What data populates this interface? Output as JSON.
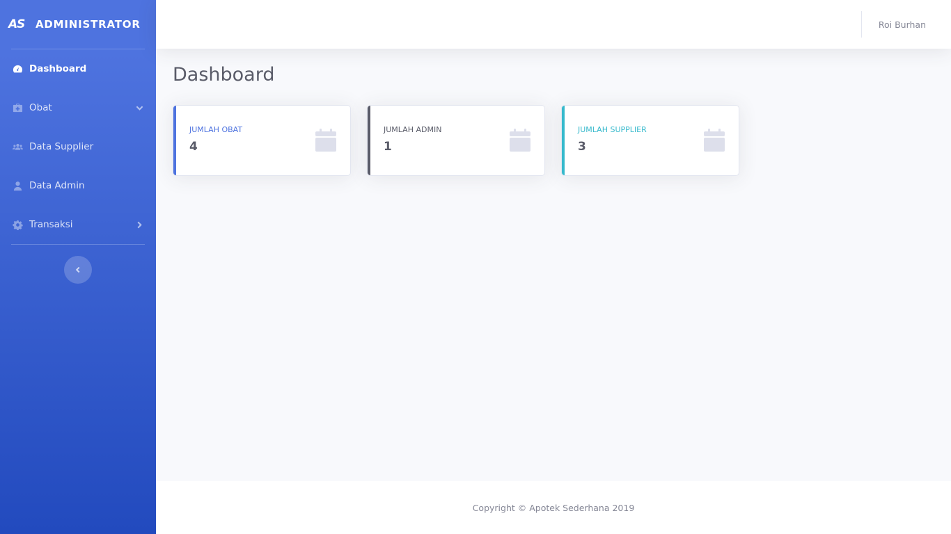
{
  "sidebar": {
    "brand_logo": "AS",
    "brand_text": "ADMINISTRATOR",
    "items": [
      {
        "label": "Dashboard",
        "icon": "tachometer-icon",
        "active": true
      },
      {
        "label": "Obat",
        "icon": "medkit-icon",
        "caret": "chevron-down-icon"
      },
      {
        "label": "Data Supplier",
        "icon": "users-icon"
      },
      {
        "label": "Data Admin",
        "icon": "user-icon"
      },
      {
        "label": "Transaksi",
        "icon": "cog-icon",
        "caret": "chevron-right-icon"
      }
    ],
    "toggle_icon": "chevron-left-icon",
    "gradient_top": "#4e73df",
    "gradient_bottom": "#224abe"
  },
  "topbar": {
    "user_name": "Roi Burhan"
  },
  "main": {
    "title": "Dashboard",
    "cards": [
      {
        "label": "JUMLAH OBAT",
        "value": "4",
        "accent": "#4e73df",
        "icon": "calendar-icon"
      },
      {
        "label": "JUMLAH ADMIN",
        "value": "1",
        "accent": "#5a5c69",
        "icon": "calendar-icon"
      },
      {
        "label": "JUMLAH SUPPLIER",
        "value": "3",
        "accent": "#36b9cc",
        "icon": "calendar-icon"
      }
    ]
  },
  "footer": {
    "copyright": "Copyright © Apotek Sederhana 2019"
  }
}
